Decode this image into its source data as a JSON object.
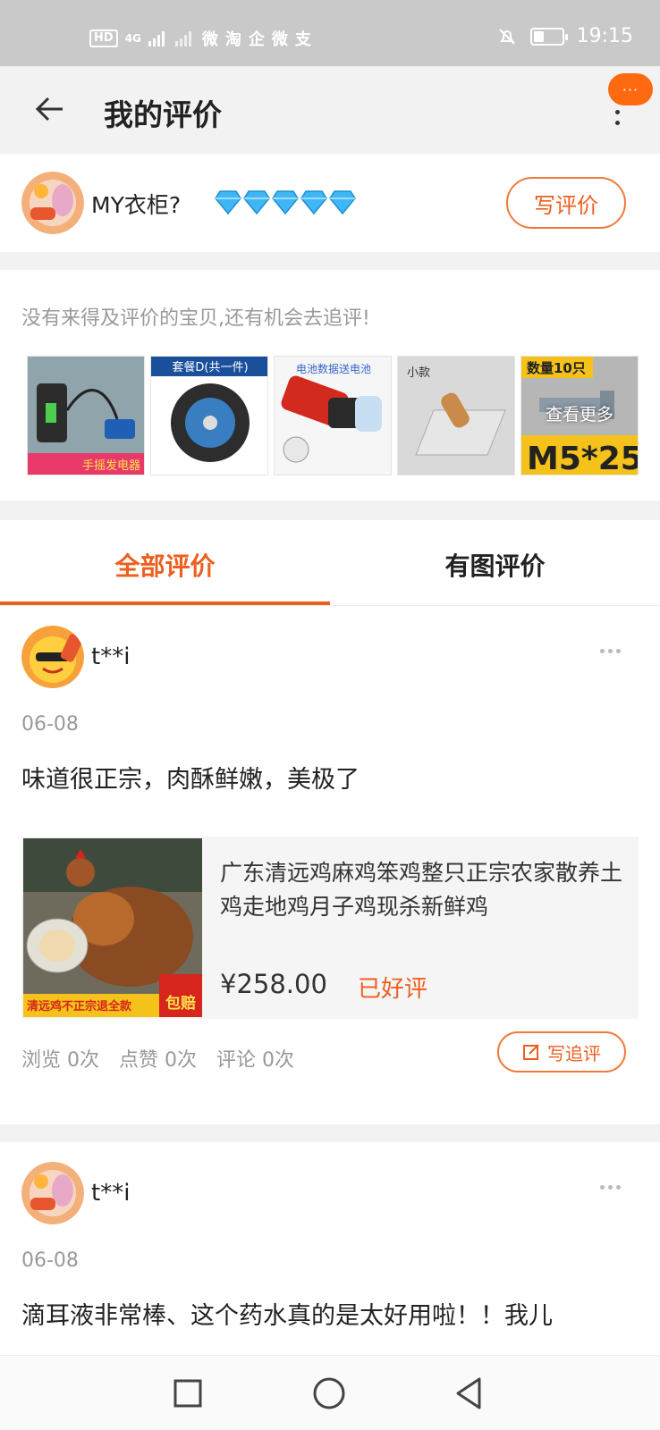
{
  "status_bar": {
    "hd_label": "HD",
    "network": "4G",
    "apps": [
      "微",
      "淘",
      "企",
      "微",
      "支"
    ],
    "time": "19:15",
    "battery_level": 0.35
  },
  "header": {
    "title": "我的评价",
    "pill_label": "···"
  },
  "profile": {
    "name": "MY衣柜?",
    "diamond_count": 5,
    "write_review_label": "写评价"
  },
  "pending": {
    "tip": "没有来得及评价的宝贝,还有机会去追评!",
    "thumbs": [
      {
        "caption": "手摇发电器"
      },
      {
        "caption": "套餐D(共一件)"
      },
      {
        "caption": "电池数据送电池"
      },
      {
        "caption": "小款"
      },
      {
        "caption": "数量10只"
      }
    ],
    "see_more_label": "查看更多"
  },
  "tabs": [
    {
      "label": "全部评价",
      "active": true
    },
    {
      "label": "有图评价",
      "active": false
    }
  ],
  "reviews": [
    {
      "user": "t**i",
      "date": "06-08",
      "text": "味道很正宗，肉酥鲜嫩，美极了",
      "product": {
        "title": "广东清远鸡麻鸡笨鸡整只正宗农家散养土鸡走地鸡月子鸡现杀新鲜鸡",
        "price": "¥258.00",
        "status": "已好评",
        "image_banner": "清远鸡不正宗退全款",
        "image_tag": "包赔"
      },
      "stats": [
        "浏览 0次",
        "点赞 0次",
        "评论 0次"
      ],
      "followup_label": "写追评"
    },
    {
      "user": "t**i",
      "date": "06-08",
      "text": "滴耳液非常棒、这个药水真的是太好用啦！！我儿"
    }
  ]
}
